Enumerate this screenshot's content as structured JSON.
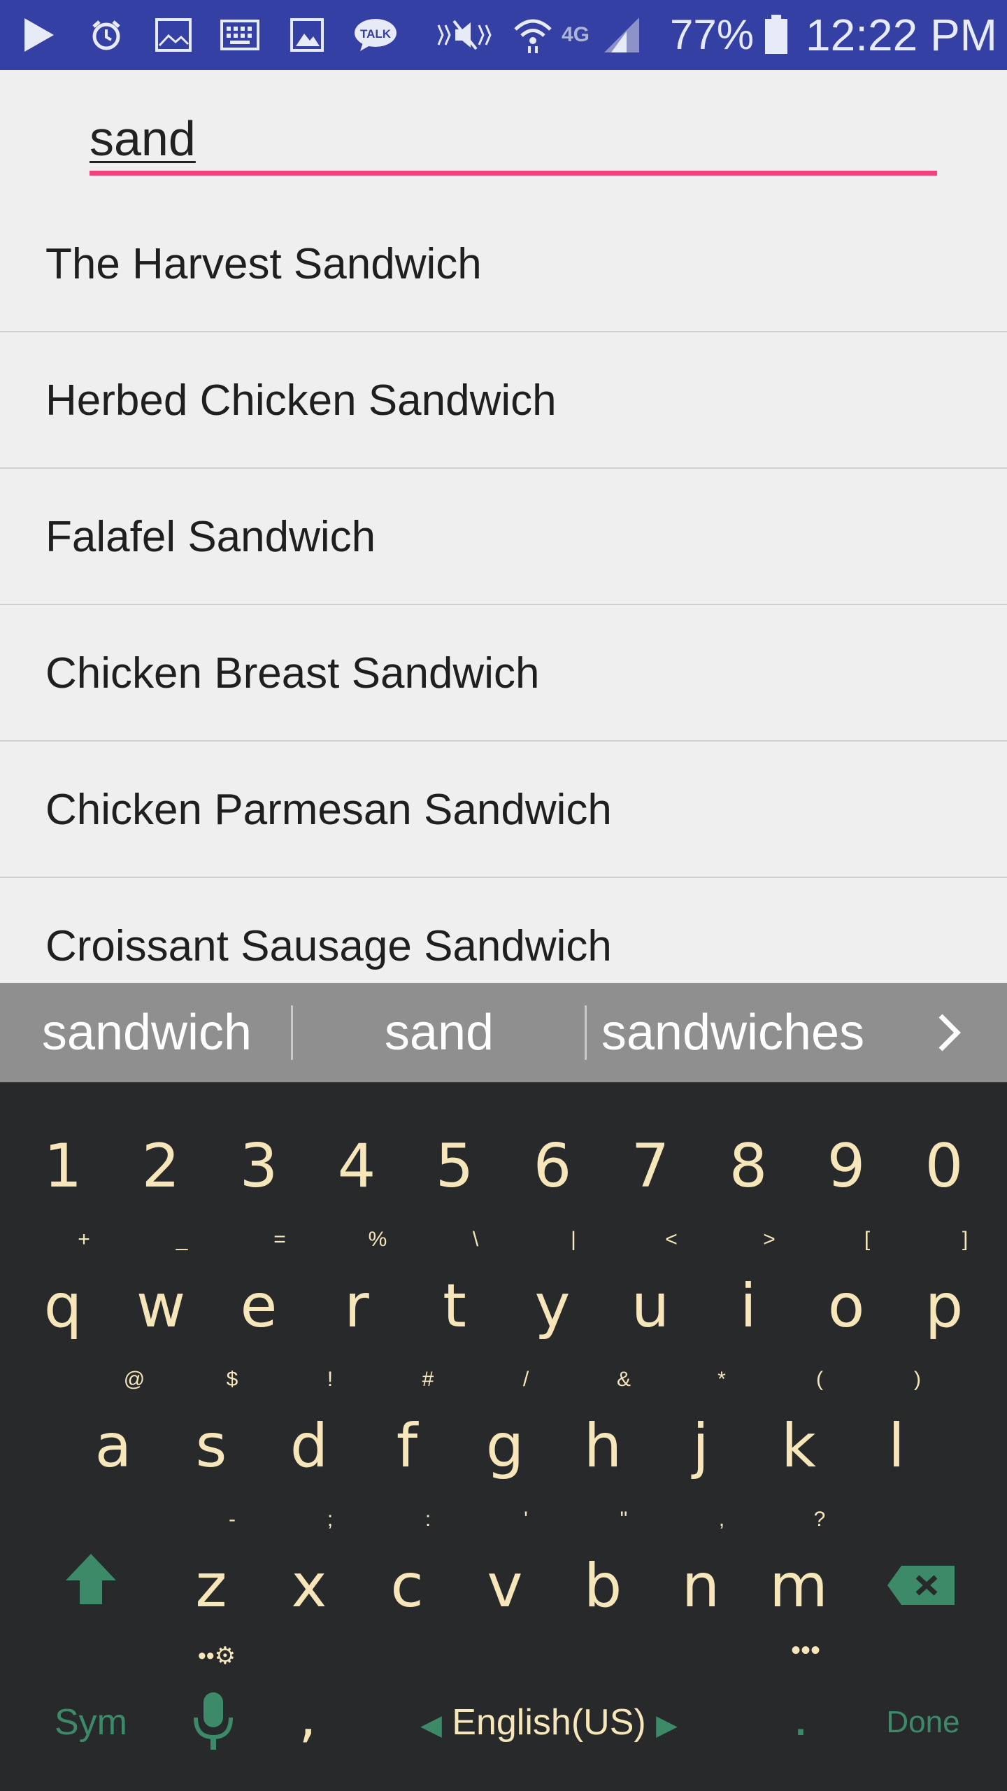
{
  "status_bar": {
    "battery_percent": "77%",
    "time": "12:22 PM",
    "network": "4G",
    "icons": [
      "play-icon",
      "alarm-icon",
      "gallery-icon",
      "keyboard-icon",
      "image-icon",
      "talk-icon",
      "mute-icon",
      "wifi-icon",
      "signal-icon",
      "battery-icon"
    ]
  },
  "search": {
    "value": "sand",
    "placeholder": ""
  },
  "results": [
    {
      "label": "The Harvest Sandwich"
    },
    {
      "label": "Herbed Chicken Sandwich"
    },
    {
      "label": "Falafel Sandwich"
    },
    {
      "label": "Chicken Breast Sandwich"
    },
    {
      "label": "Chicken Parmesan Sandwich"
    },
    {
      "label": "Croissant Sausage Sandwich"
    }
  ],
  "suggestions": [
    "sandwich",
    "sand",
    "sandwiches"
  ],
  "keyboard": {
    "number_row": [
      "1",
      "2",
      "3",
      "4",
      "5",
      "6",
      "7",
      "8",
      "9",
      "0"
    ],
    "number_hints": [
      "+",
      "_",
      "=",
      "%",
      "\\",
      "|",
      "<",
      ">",
      "[",
      "]"
    ],
    "row1": [
      "q",
      "w",
      "e",
      "r",
      "t",
      "y",
      "u",
      "i",
      "o",
      "p"
    ],
    "row1_hints": [
      "@",
      "$",
      "!",
      "#",
      "/",
      "&",
      "*",
      "(",
      ")"
    ],
    "row2": [
      "a",
      "s",
      "d",
      "f",
      "g",
      "h",
      "j",
      "k",
      "l"
    ],
    "row2_hints": [
      "-",
      ";",
      ":",
      "'",
      "\"",
      ",",
      "?"
    ],
    "row3": [
      "z",
      "x",
      "c",
      "v",
      "b",
      "n",
      "m"
    ],
    "sym_label": "Sym",
    "comma_label": ",",
    "language_label": "English(US)",
    "period_label": ".",
    "done_label": "Done",
    "settings_hint": "••",
    "more_hint": "•••",
    "text_color": "#f7e6b9",
    "accent_color": "#3d8a68"
  }
}
